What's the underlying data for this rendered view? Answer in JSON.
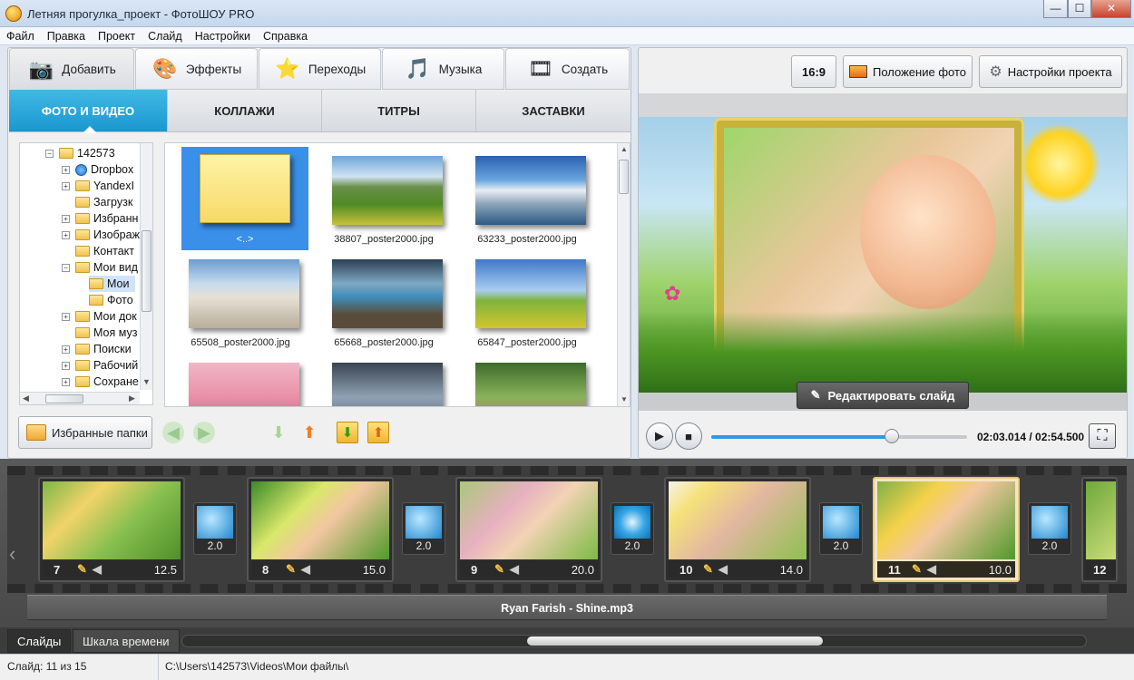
{
  "window": {
    "title": "Летняя прогулка_проект - ФотоШОУ PRO",
    "minimize": "—",
    "maximize": "☐",
    "close": "✕"
  },
  "menu": [
    "Файл",
    "Правка",
    "Проект",
    "Слайд",
    "Настройки",
    "Справка"
  ],
  "main_tabs": [
    {
      "label": "Добавить",
      "icon": "camera-icon",
      "glyph": "📷"
    },
    {
      "label": "Эффекты",
      "icon": "palette-icon",
      "glyph": "🎨"
    },
    {
      "label": "Переходы",
      "icon": "star-icon",
      "glyph": "⭐"
    },
    {
      "label": "Музыка",
      "icon": "music-note-icon",
      "glyph": "🎵"
    },
    {
      "label": "Создать",
      "icon": "film-reel-icon",
      "glyph": "🎞"
    }
  ],
  "sub_tabs": [
    "ФОТО И ВИДЕО",
    "КОЛЛАЖИ",
    "ТИТРЫ",
    "ЗАСТАВКИ"
  ],
  "tree": [
    {
      "label": "142573",
      "expander": "−"
    },
    {
      "label": "Dropbox",
      "expander": "+"
    },
    {
      "label": "YandexI",
      "expander": "+"
    },
    {
      "label": "Загрузк",
      "expander": ""
    },
    {
      "label": "Избранн",
      "expander": "+"
    },
    {
      "label": "Изображ",
      "expander": "+"
    },
    {
      "label": "Контакт",
      "expander": ""
    },
    {
      "label": "Мои вид",
      "expander": "−"
    },
    {
      "label": "Мои",
      "expander": ""
    },
    {
      "label": "Фото",
      "expander": ""
    },
    {
      "label": "Мои док",
      "expander": "+"
    },
    {
      "label": "Моя муз",
      "expander": ""
    },
    {
      "label": "Поиски",
      "expander": "+"
    },
    {
      "label": "Рабочий",
      "expander": "+"
    },
    {
      "label": "Сохране",
      "expander": "+"
    }
  ],
  "gallery": [
    {
      "caption": "<..>"
    },
    {
      "caption": "38807_poster2000.jpg"
    },
    {
      "caption": "63233_poster2000.jpg"
    },
    {
      "caption": "65508_poster2000.jpg"
    },
    {
      "caption": "65668_poster2000.jpg"
    },
    {
      "caption": "65847_poster2000.jpg"
    },
    {
      "caption": ""
    },
    {
      "caption": ""
    },
    {
      "caption": ""
    }
  ],
  "favorites_button": "Избранные папки",
  "right_buttons": {
    "ratio": "16:9",
    "photo_position": "Положение фото",
    "project_settings": "Настройки проекта"
  },
  "edit_slide_button": "Редактировать слайд",
  "playback": {
    "time": "02:03.014 / 02:54.500",
    "progress": 0.706
  },
  "slides": [
    {
      "number": "7",
      "duration": "12.5"
    },
    {
      "number": "8",
      "duration": "15.0"
    },
    {
      "number": "9",
      "duration": "20.0"
    },
    {
      "number": "10",
      "duration": "14.0"
    },
    {
      "number": "11",
      "duration": "10.0"
    },
    {
      "number": "12",
      "duration": ""
    }
  ],
  "transitions": [
    "2.0",
    "2.0",
    "2.0",
    "2.0",
    "2.0"
  ],
  "music_track": "Ryan Farish - Shine.mp3",
  "view_tabs": [
    "Слайды",
    "Шкала времени"
  ],
  "status": {
    "slide": "Слайд: 11 из 15",
    "path": "C:\\Users\\142573\\Videos\\Мои файлы\\"
  }
}
